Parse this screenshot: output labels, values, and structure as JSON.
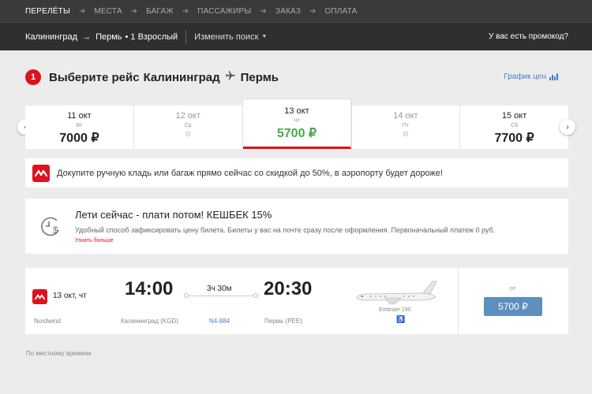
{
  "steps": [
    {
      "label": "ПЕРЕЛЁТЫ",
      "active": true
    },
    {
      "label": "МЕСТА",
      "active": false
    },
    {
      "label": "БАГАЖ",
      "active": false
    },
    {
      "label": "ПАССАЖИРЫ",
      "active": false
    },
    {
      "label": "ЗАКАЗ",
      "active": false
    },
    {
      "label": "ОПЛАТА",
      "active": false
    }
  ],
  "search": {
    "from": "Калининград",
    "to": "Пермь",
    "passengers": "• 1 Взрослый",
    "change_label": "Изменить поиск",
    "promo_label": "У вас есть промокод?"
  },
  "title": {
    "step_number": "1",
    "prefix": "Выберите рейс",
    "from": "Калининград",
    "to": "Пермь",
    "price_graph": "График цен"
  },
  "dates": [
    {
      "date": "11 окт",
      "dow": "Вт",
      "price": "7000 ₽",
      "state": "normal"
    },
    {
      "date": "12 окт",
      "dow": "Ср",
      "price": "",
      "state": "muted"
    },
    {
      "date": "13 окт",
      "dow": "Чт",
      "price": "5700 ₽",
      "state": "selected"
    },
    {
      "date": "14 окт",
      "dow": "Пт",
      "price": "",
      "state": "muted"
    },
    {
      "date": "15 окт",
      "dow": "Сб",
      "price": "7700 ₽",
      "state": "normal"
    }
  ],
  "banner": {
    "text": "Докупите ручную кладь или багаж прямо сейчас со скидкой до 50%, в аэропорту будет дороже!"
  },
  "cashback": {
    "title": "Лети сейчас - плати потом! КЕШБЕК 15%",
    "description": "Удобный способ зафиксировать цену билета. Билеты у вас на почте сразу после оформления. Первоначальный платеж 0 руб.",
    "more": "Узнать больше"
  },
  "flight": {
    "date": "13 окт, чт",
    "airline": "Nordwind",
    "dep_time": "14:00",
    "dep_city": "Калининград (KGD)",
    "duration": "3ч 30м",
    "flight_number": "N4-884",
    "arr_time": "20:30",
    "arr_city": "Пермь (PEE)",
    "aircraft": "Embraer 190",
    "from_label": "от",
    "price": "5700 ₽"
  },
  "footnote": "По местному времени",
  "colors": {
    "brand_red": "#d9141f",
    "price_green": "#4aa84a",
    "button_blue": "#5d8fbf",
    "link_blue": "#4a7ec8"
  }
}
